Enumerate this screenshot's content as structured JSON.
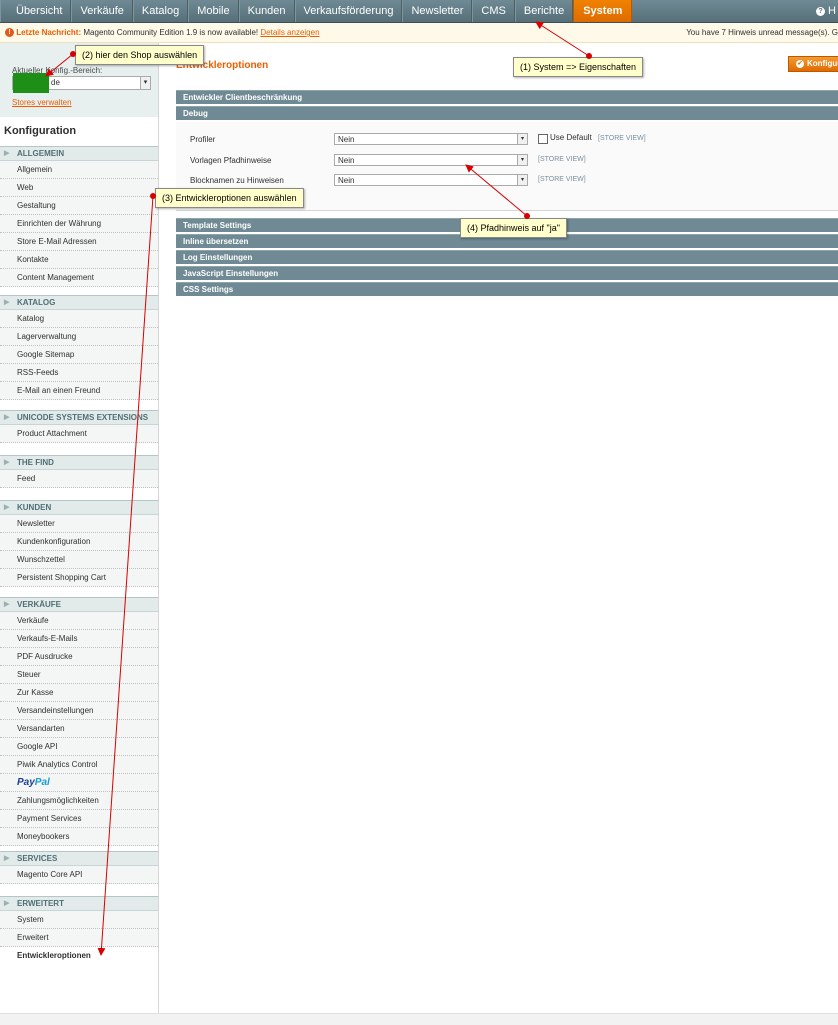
{
  "topnav": {
    "items": [
      "Übersicht",
      "Verkäufe",
      "Katalog",
      "Mobile",
      "Kunden",
      "Verkaufsförderung",
      "Newsletter",
      "CMS",
      "Berichte",
      "System"
    ],
    "active": "System",
    "help_label": "H"
  },
  "message": {
    "label": "Letzte Nachricht:",
    "text": "Magento Community Edition 1.9 is now available!",
    "link": "Details anzeigen",
    "right": "You have 7 Hinweis unread message(s). G"
  },
  "sidebar": {
    "scope_label": "Aktueller Konfig.-Bereich:",
    "scope_value": "de",
    "stores_link": "Stores verwalten",
    "title": "Konfiguration",
    "groups": [
      {
        "name": "ALLGEMEIN",
        "items": [
          "Allgemein",
          "Web",
          "Gestaltung",
          "Einrichten der Währung",
          "Store E-Mail Adressen",
          "Kontakte",
          "Content Management"
        ]
      },
      {
        "name": "KATALOG",
        "items": [
          "Katalog",
          "Lagerverwaltung",
          "Google Sitemap",
          "RSS-Feeds",
          "E-Mail an einen Freund"
        ]
      },
      {
        "name": "UNICODE SYSTEMS EXTENSIONS",
        "items": [
          "Product Attachment"
        ]
      },
      {
        "name": "THE FIND",
        "items": [
          "Feed"
        ]
      },
      {
        "name": "KUNDEN",
        "items": [
          "Newsletter",
          "Kundenkonfiguration",
          "Wunschzettel",
          "Persistent Shopping Cart"
        ]
      },
      {
        "name": "VERKÄUFE",
        "items": [
          "Verkäufe",
          "Verkaufs-E-Mails",
          "PDF Ausdrucke",
          "Steuer",
          "Zur Kasse",
          "Versandeinstellungen",
          "Versandarten",
          "Google API",
          "Piwik Analytics Control",
          "PayPal",
          "Zahlungsmöglichkeiten",
          "Payment Services",
          "Moneybookers"
        ]
      },
      {
        "name": "SERVICES",
        "items": [
          "Magento Core API"
        ]
      },
      {
        "name": "ERWEITERT",
        "items": [
          "System",
          "Erweitert",
          "Entwickleroptionen"
        ]
      }
    ],
    "active_item": "Entwickleroptionen"
  },
  "main": {
    "title": "Entwickleroptionen",
    "save_label": "Konfiguration speichern",
    "sections": {
      "client": "Entwickler Clientbeschränkung",
      "debug": "Debug",
      "template": "Template Settings",
      "inline": "Inline übersetzen",
      "log": "Log Einstellungen",
      "js": "JavaScript Einstellungen",
      "css": "CSS Settings"
    },
    "debug_rows": [
      {
        "label": "Profiler",
        "value": "Nein",
        "use_default": "Use Default",
        "scope": "[STORE VIEW]"
      },
      {
        "label": "Vorlagen Pfadhinweise",
        "value": "Nein",
        "scope": "[STORE VIEW]"
      },
      {
        "label": "Blocknamen zu Hinweisen",
        "value": "Nein",
        "scope": "[STORE VIEW]"
      }
    ]
  },
  "annotations": {
    "a1": "(1) System => Eigenschaften",
    "a2": "(2) hier den Shop auswählen",
    "a3": "(3) Entwickleroptionen auswählen",
    "a4": "(4) Pfadhinweis auf \"ja\""
  },
  "colors": {
    "accent": "#eb5e00",
    "nav": "#566f79",
    "annotation": "#ffffcc",
    "arrow": "#d80000"
  }
}
